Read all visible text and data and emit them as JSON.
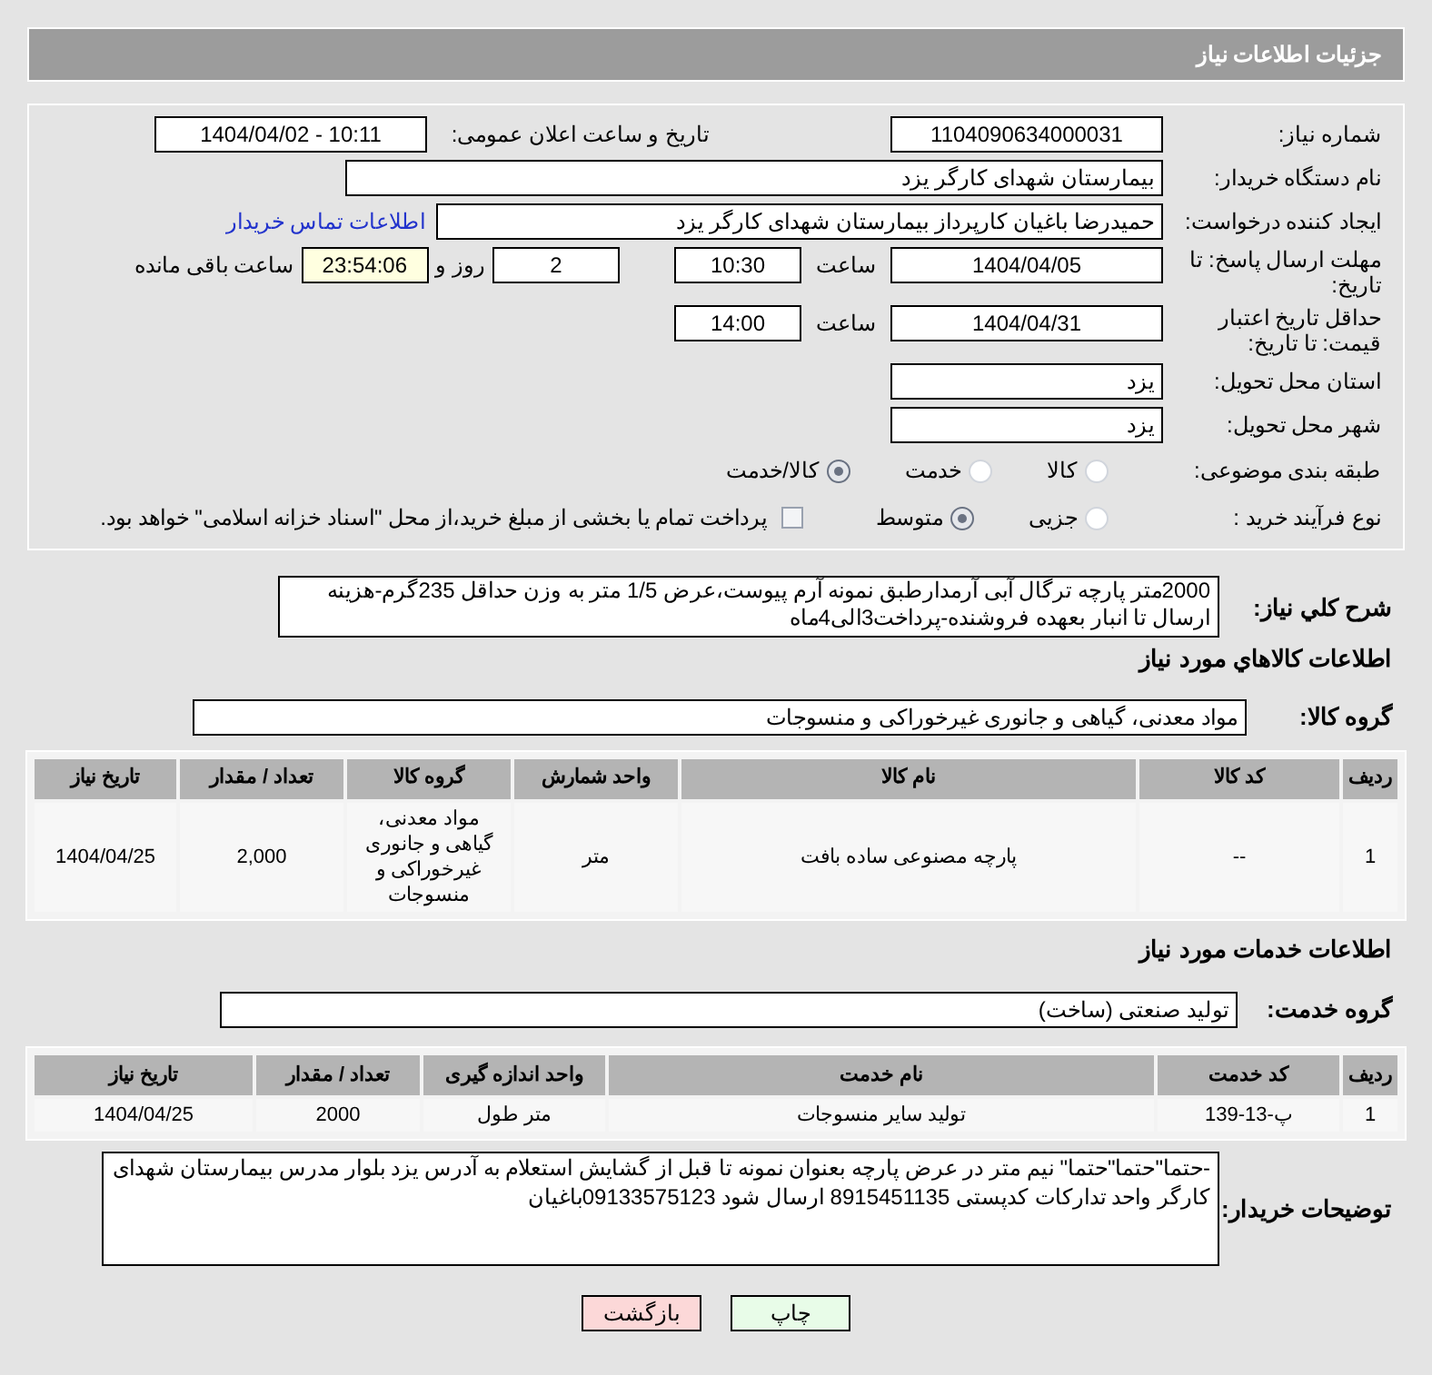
{
  "header": {
    "title": "جزئیات اطلاعات نیاز"
  },
  "form": {
    "need_number": {
      "label": "شماره نیاز:",
      "value": "1104090634000031"
    },
    "announce": {
      "label": "تاریخ و ساعت اعلان عمومی:",
      "value": "1404/04/02 - 10:11"
    },
    "buyer": {
      "label": "نام دستگاه خریدار:",
      "value": "بیمارستان شهدای کارگر یزد"
    },
    "creator": {
      "label": "ایجاد کننده درخواست:",
      "value": "حمیدرضا باغیان کارپرداز بیمارستان شهدای کارگر یزد",
      "link": "اطلاعات تماس خریدار"
    },
    "deadline": {
      "label": "مهلت ارسال پاسخ: تا تاریخ:",
      "date": "1404/04/05",
      "time_label": "ساعت",
      "time": "10:30",
      "days": "2",
      "days_label": "روز و",
      "remaining": "23:54:06",
      "remaining_label": "ساعت باقی مانده"
    },
    "validity": {
      "label": "حداقل تاریخ اعتبار قیمت: تا تاریخ:",
      "date": "1404/04/31",
      "time_label": "ساعت",
      "time": "14:00"
    },
    "province": {
      "label": "استان محل تحویل:",
      "value": "یزد"
    },
    "city": {
      "label": "شهر محل تحویل:",
      "value": "یزد"
    },
    "category": {
      "label": "طبقه بندی موضوعی:",
      "options": [
        {
          "label": "کالا",
          "selected": false
        },
        {
          "label": "خدمت",
          "selected": false
        },
        {
          "label": "کالا/خدمت",
          "selected": true
        }
      ]
    },
    "process": {
      "label": "نوع فرآیند خرید :",
      "options": [
        {
          "label": "جزیی",
          "selected": false
        },
        {
          "label": "متوسط",
          "selected": true
        }
      ],
      "treasury": {
        "checked": false,
        "text": "پرداخت تمام یا بخشی از مبلغ خرید،از محل \"اسناد خزانه اسلامی\" خواهد بود."
      }
    }
  },
  "description": {
    "label": "شرح کلي نیاز:",
    "text": "2000متر پارچه ترگال آبی آرمدارطبق نمونه آرم پیوست،عرض 1/5 متر  به وزن حداقل 235گرم-هزینه ارسال تا انبار بعهده فروشنده-پرداخت3الی4ماه"
  },
  "goods": {
    "heading": "اطلاعات کالاهاي مورد نیاز",
    "group_label": "گروه کالا:",
    "group": "مواد معدنی، گیاهی و جانوری غیرخوراکی و منسوجات",
    "columns": [
      "ردیف",
      "کد کالا",
      "نام کالا",
      "واحد شمارش",
      "گروه کالا",
      "تعداد / مقدار",
      "تاریخ نیاز"
    ],
    "rows": [
      [
        "1",
        "--",
        "پارچه مصنوعی ساده بافت",
        "متر",
        "مواد معدنی، گیاهی و جانوری غیرخوراکی و منسوجات",
        "2,000",
        "1404/04/25"
      ]
    ]
  },
  "services": {
    "heading": "اطلاعات خدمات مورد نیاز",
    "group_label": "گروه خدمت:",
    "group": "تولید صنعتی (ساخت)",
    "columns": [
      "ردیف",
      "کد خدمت",
      "نام خدمت",
      "واحد اندازه گیری",
      "تعداد / مقدار",
      "تاریخ نیاز"
    ],
    "rows": [
      [
        "1",
        "پ-13-139",
        "تولید سایر منسوجات",
        "متر طول",
        "2000",
        "1404/04/25"
      ]
    ]
  },
  "notes": {
    "label": "توضیحات خریدار:",
    "text": "-حتما\"حتما\"حتما\" نیم متر در عرض پارچه بعنوان نمونه تا قبل از گشایش استعلام به آدرس یزد بلوار مدرس بیمارستان شهدای کارگر واحد تدارکات کدپستی 8915451135 ارسال شود 09133575123باغیان"
  },
  "buttons": [
    {
      "kind": "print",
      "label": "چاپ"
    },
    {
      "kind": "back",
      "label": "بازگشت"
    }
  ]
}
